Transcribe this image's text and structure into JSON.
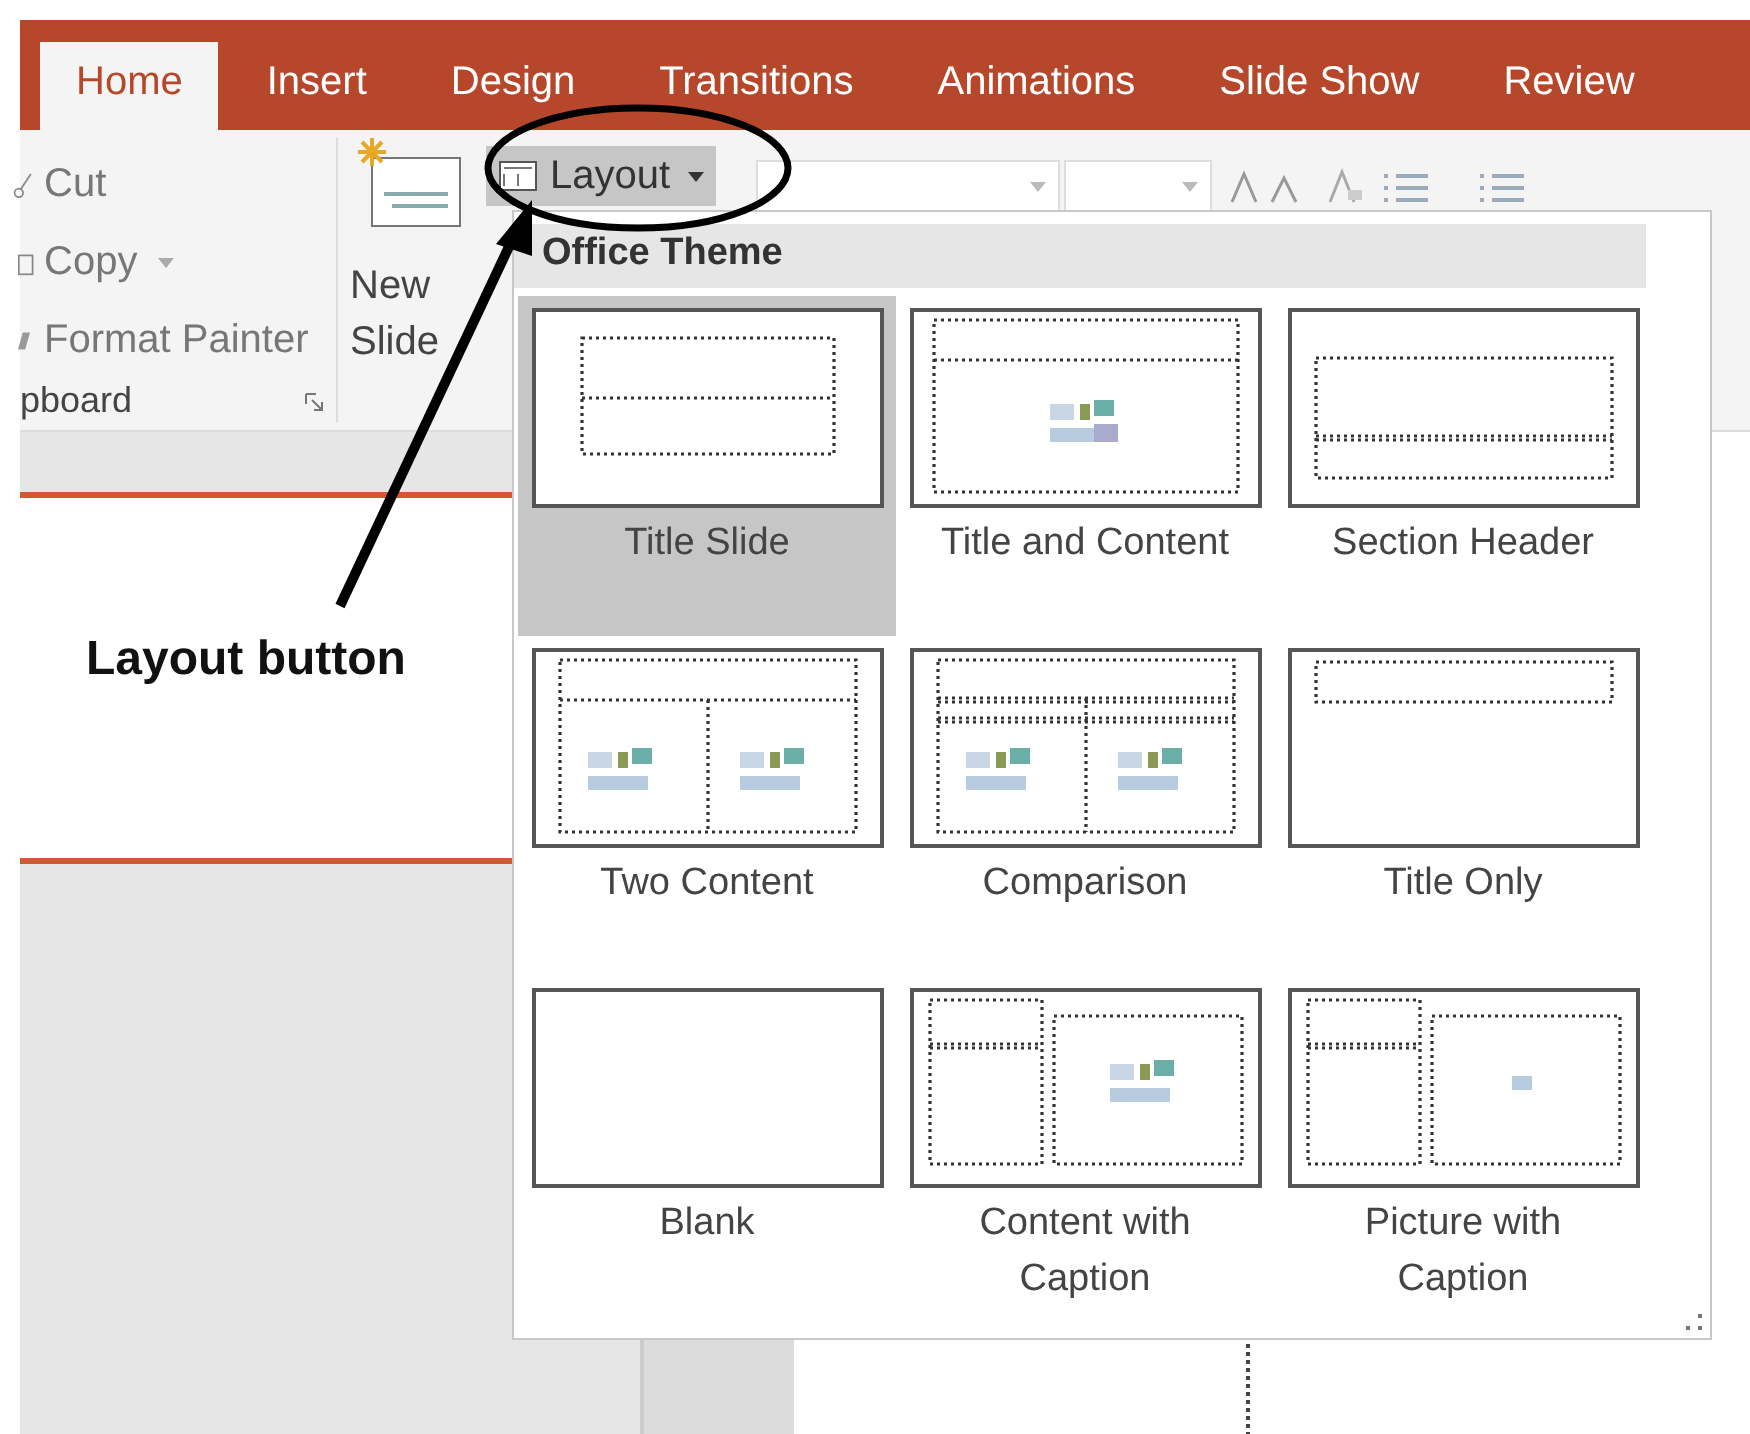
{
  "tabs": [
    {
      "label": "Home",
      "selected": true
    },
    {
      "label": "Insert",
      "selected": false
    },
    {
      "label": "Design",
      "selected": false
    },
    {
      "label": "Transitions",
      "selected": false
    },
    {
      "label": "Animations",
      "selected": false
    },
    {
      "label": "Slide Show",
      "selected": false
    },
    {
      "label": "Review",
      "selected": false
    }
  ],
  "clipboard": {
    "items": [
      {
        "label": "Cut",
        "kind": "cut",
        "dropdown": false
      },
      {
        "label": "Copy",
        "kind": "copy",
        "dropdown": true
      },
      {
        "label": "Format Painter",
        "kind": "painter",
        "dropdown": false
      }
    ],
    "group_label": "pboard"
  },
  "new_slide": {
    "label": "New Slide"
  },
  "layout_button": {
    "label": "Layout",
    "pressed": true
  },
  "layout_menu": {
    "heading": "Office Theme",
    "layouts": [
      {
        "label": "Title Slide",
        "kind": "title",
        "selected": true
      },
      {
        "label": "Title and Content",
        "kind": "title-content",
        "selected": false
      },
      {
        "label": "Section Header",
        "kind": "section",
        "selected": false
      },
      {
        "label": "Two Content",
        "kind": "two-content",
        "selected": false
      },
      {
        "label": "Comparison",
        "kind": "comparison",
        "selected": false
      },
      {
        "label": "Title Only",
        "kind": "title-only",
        "selected": false
      },
      {
        "label": "Blank",
        "kind": "blank",
        "selected": false
      },
      {
        "label": "Content with Caption",
        "kind": "content-caption",
        "selected": false
      },
      {
        "label": "Picture with Caption",
        "kind": "picture-caption",
        "selected": false
      }
    ]
  },
  "annotation": {
    "label": "Layout button"
  }
}
